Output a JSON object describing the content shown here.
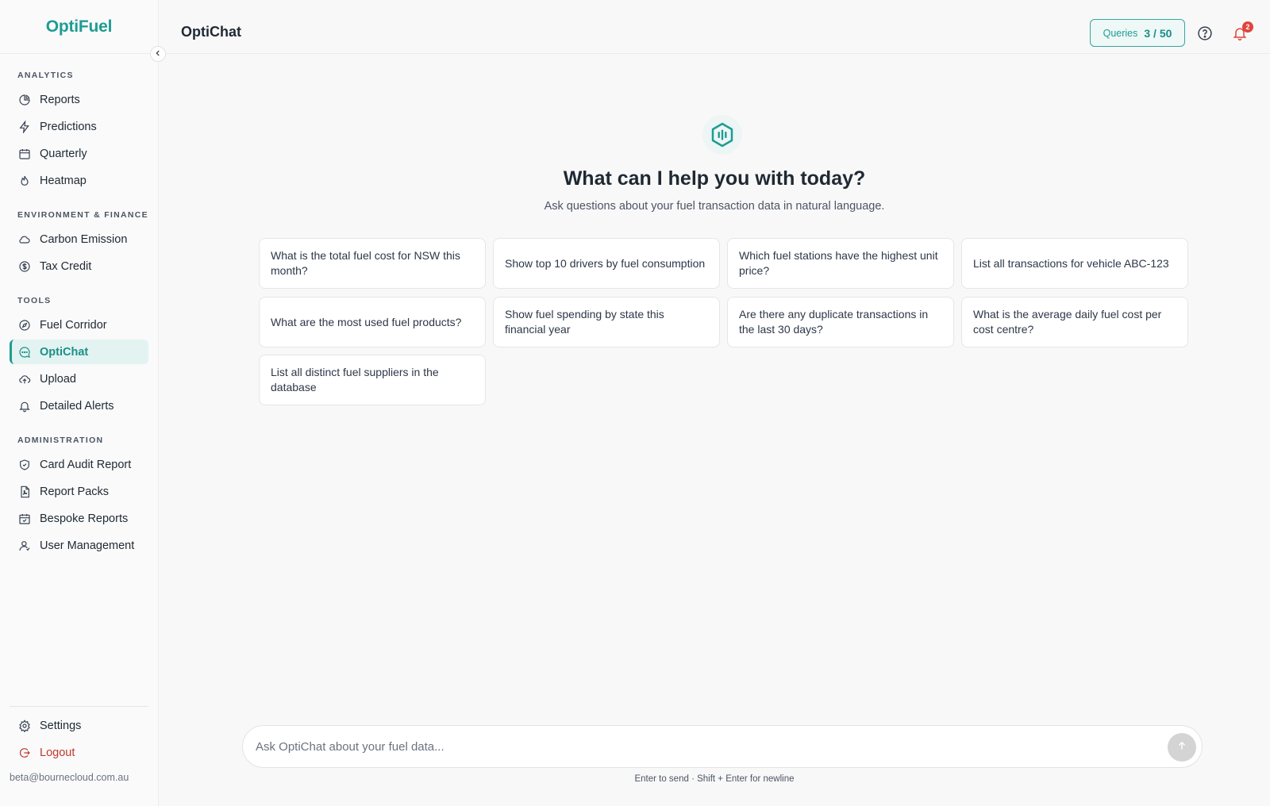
{
  "brand": {
    "name": "OptiFuel"
  },
  "header": {
    "title": "OptiChat",
    "queries_label": "Queries",
    "queries_count": "3 / 50",
    "notification_count": "2"
  },
  "sidebar": {
    "sections": [
      {
        "label": "ANALYTICS",
        "items": [
          {
            "label": "Reports",
            "icon": "pie-chart-icon"
          },
          {
            "label": "Predictions",
            "icon": "lightning-icon"
          },
          {
            "label": "Quarterly",
            "icon": "calendar-icon"
          },
          {
            "label": "Heatmap",
            "icon": "flame-icon"
          }
        ]
      },
      {
        "label": "ENVIRONMENT & FINANCE",
        "items": [
          {
            "label": "Carbon Emission",
            "icon": "cloud-icon"
          },
          {
            "label": "Tax Credit",
            "icon": "dollar-circle-icon"
          }
        ]
      },
      {
        "label": "TOOLS",
        "items": [
          {
            "label": "Fuel Corridor",
            "icon": "compass-icon"
          },
          {
            "label": "OptiChat",
            "icon": "chat-icon",
            "active": true
          },
          {
            "label": "Upload",
            "icon": "cloud-upload-icon"
          },
          {
            "label": "Detailed Alerts",
            "icon": "bell-icon"
          }
        ]
      },
      {
        "label": "ADMINISTRATION",
        "items": [
          {
            "label": "Card Audit Report",
            "icon": "shield-check-icon"
          },
          {
            "label": "Report Packs",
            "icon": "file-pdf-icon"
          },
          {
            "label": "Bespoke Reports",
            "icon": "calendar-check-icon"
          },
          {
            "label": "User Management",
            "icon": "user-icon"
          }
        ]
      }
    ],
    "bottom": {
      "settings": "Settings",
      "logout": "Logout",
      "user_email": "beta@bournecloud.com.au"
    }
  },
  "main": {
    "heading": "What can I help you with today?",
    "subheading": "Ask questions about your fuel transaction data in natural language.",
    "suggestions": [
      "What is the total fuel cost for NSW this month?",
      "Show top 10 drivers by fuel consumption",
      "Which fuel stations have the highest unit price?",
      "List all transactions for vehicle ABC-123",
      "What are the most used fuel products?",
      "Show fuel spending by state this financial year",
      "Are there any duplicate transactions in the last 30 days?",
      "What is the average daily fuel cost per cost centre?",
      "List all distinct fuel suppliers in the database"
    ],
    "input_placeholder": "Ask OptiChat about your fuel data...",
    "hint": "Enter to send · Shift + Enter for newline"
  },
  "colors": {
    "accent": "#1f9c93",
    "active_bg": "#e3f3f1",
    "logout": "#c0392b",
    "badge": "#e0453a"
  }
}
